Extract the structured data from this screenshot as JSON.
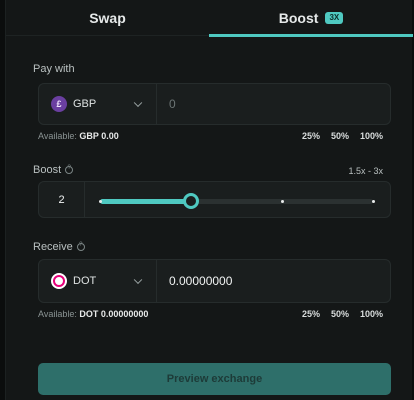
{
  "tabs": {
    "swap": "Swap",
    "boost": "Boost",
    "boost_badge": "3X"
  },
  "pay": {
    "label": "Pay with",
    "currency": "GBP",
    "currency_icon": "£",
    "amount_placeholder": "0",
    "available_prefix": "Available:",
    "available_value": "GBP 0.00",
    "percent_options": [
      "25%",
      "50%",
      "100%"
    ]
  },
  "boost": {
    "label": "Boost",
    "range_text": "1.5x - 3x",
    "value": "2",
    "slider_min": 1.5,
    "slider_max": 3,
    "slider_level": 2,
    "ticks": [
      1.5,
      2,
      2.5,
      3
    ]
  },
  "receive": {
    "label": "Receive",
    "currency": "DOT",
    "amount": "0.00000000",
    "available_prefix": "Available:",
    "available_value": "DOT 0.00000000",
    "percent_options": [
      "25%",
      "50%",
      "100%"
    ]
  },
  "actions": {
    "preview_label": "Preview exchange"
  },
  "colors": {
    "accent": "#4fc9c1",
    "button": "#2e6f6a",
    "background": "#141717"
  }
}
